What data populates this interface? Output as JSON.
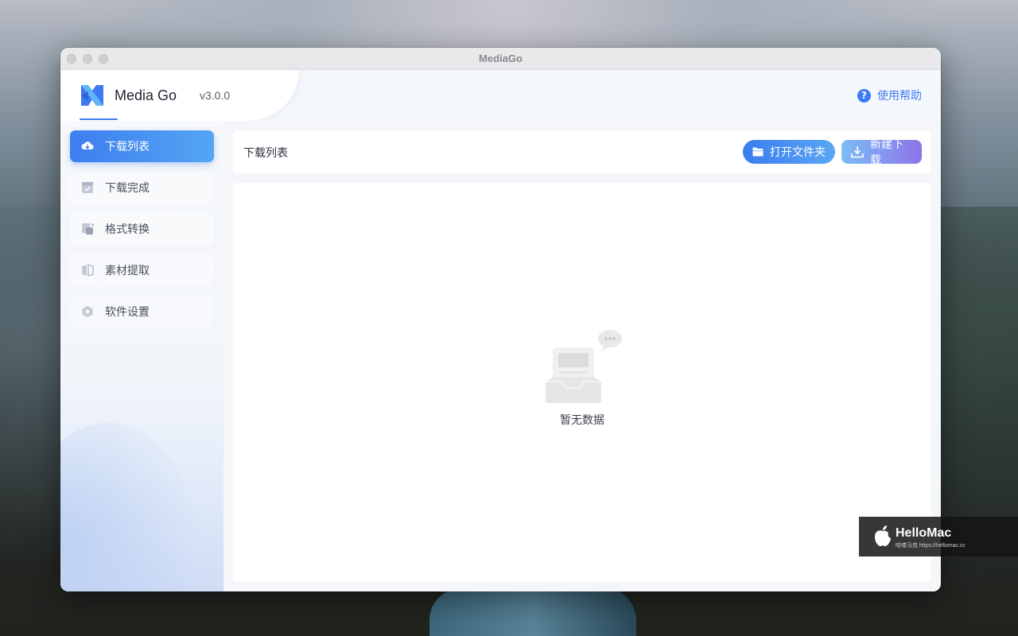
{
  "window": {
    "title": "MediaGo"
  },
  "header": {
    "brand": "Media Go",
    "version": "v3.0.0",
    "help_label": "使用帮助",
    "help_icon": "question-circle-icon"
  },
  "sidebar": {
    "items": [
      {
        "label": "下载列表",
        "icon": "cloud-download-icon",
        "active": true
      },
      {
        "label": "下载完成",
        "icon": "check-square-icon",
        "active": false
      },
      {
        "label": "格式转换",
        "icon": "convert-icon",
        "active": false
      },
      {
        "label": "素材提取",
        "icon": "extract-icon",
        "active": false
      },
      {
        "label": "软件设置",
        "icon": "hexagon-settings-icon",
        "active": false
      }
    ]
  },
  "main": {
    "title": "下载列表",
    "open_folder_label": "打开文件夹",
    "new_download_label": "新建下载",
    "empty_text": "暂无数据"
  },
  "watermark": {
    "name": "HelloMac",
    "sub": "哈喽马克 https://hellomac.cc"
  },
  "colors": {
    "accent": "#3b7cf0",
    "accent_light": "#54a5f3",
    "new_btn_end": "#8d74e8"
  }
}
